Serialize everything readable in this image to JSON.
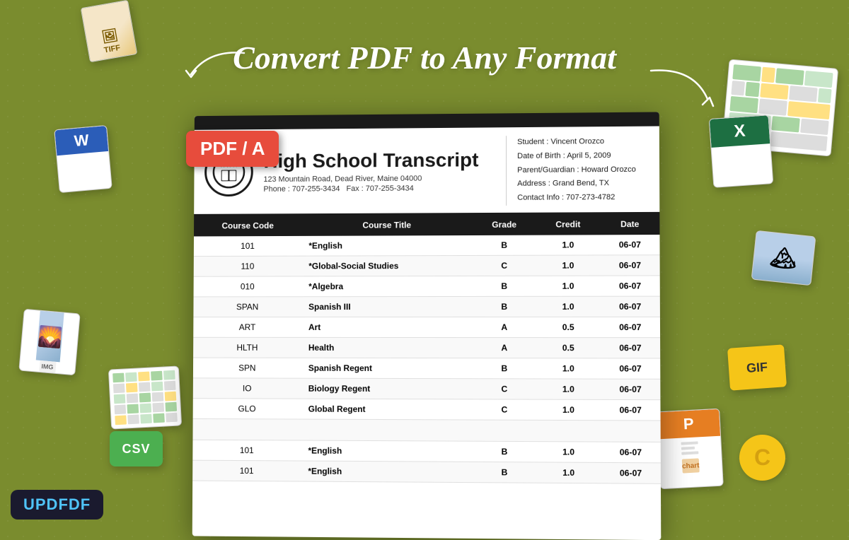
{
  "hero": {
    "title": "Convert PDF to Any Format"
  },
  "pdf_badge": {
    "label": "PDF / A"
  },
  "updf": {
    "label": "UPDF"
  },
  "document": {
    "title": "High School Transcript",
    "address": "123 Mountain Road, Dead River, Maine 04000",
    "phone": "Phone : 707-255-3434",
    "fax": "Fax : 707-255-3434",
    "student": {
      "name": "Student : Vincent Orozco",
      "dob": "Date of Birth : April 5, 2009",
      "guardian": "Parent/Guardian : Howard Orozco",
      "address": "Address : Grand Bend, TX",
      "contact": "Contact Info : 707-273-4782"
    },
    "columns": [
      "Course Code",
      "Course Title",
      "Grade",
      "Credit",
      "Date"
    ],
    "rows": [
      {
        "code": "101",
        "title": "*English",
        "grade": "B",
        "credit": "1.0",
        "date": "06-07"
      },
      {
        "code": "110",
        "title": "*Global-Social Studies",
        "grade": "C",
        "credit": "1.0",
        "date": "06-07"
      },
      {
        "code": "010",
        "title": "*Algebra",
        "grade": "B",
        "credit": "1.0",
        "date": "06-07"
      },
      {
        "code": "SPAN",
        "title": "Spanish III",
        "grade": "B",
        "credit": "1.0",
        "date": "06-07"
      },
      {
        "code": "ART",
        "title": "Art",
        "grade": "A",
        "credit": "0.5",
        "date": "06-07"
      },
      {
        "code": "HLTH",
        "title": "Health",
        "grade": "A",
        "credit": "0.5",
        "date": "06-07"
      },
      {
        "code": "SPN",
        "title": "Spanish Regent",
        "grade": "B",
        "credit": "1.0",
        "date": "06-07"
      },
      {
        "code": "IO",
        "title": "Biology Regent",
        "grade": "C",
        "credit": "1.0",
        "date": "06-07"
      },
      {
        "code": "GLO",
        "title": "Global Regent",
        "grade": "C",
        "credit": "1.0",
        "date": "06-07"
      },
      {
        "code": "101",
        "title": "*English",
        "grade": "B",
        "credit": "1.0",
        "date": "06-07"
      },
      {
        "code": "101",
        "title": "*English",
        "grade": "B",
        "credit": "1.0",
        "date": "06-07"
      }
    ]
  }
}
